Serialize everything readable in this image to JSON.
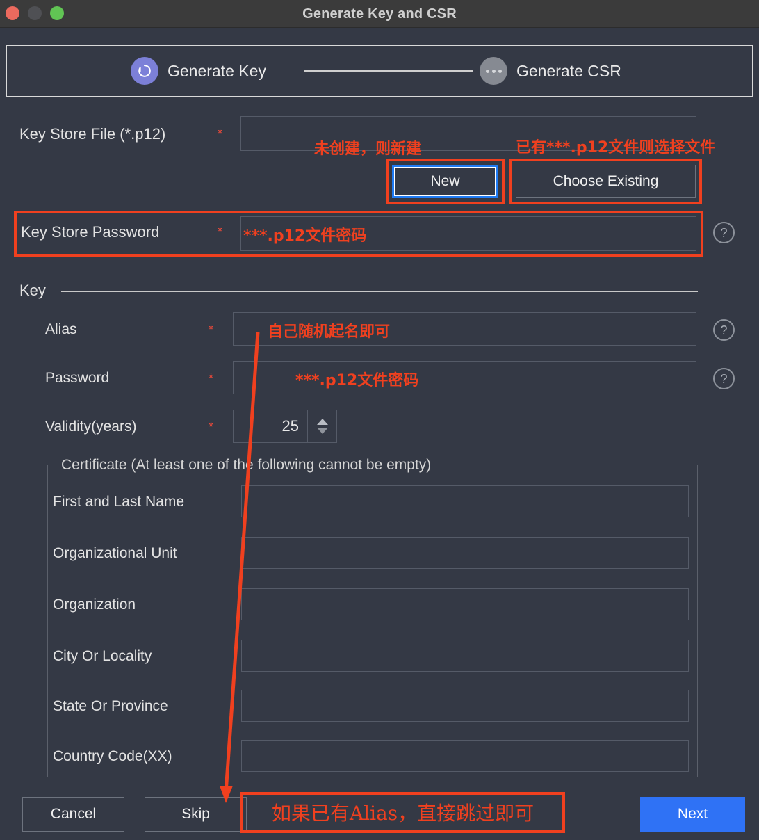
{
  "window": {
    "title": "Generate Key and CSR",
    "traffic_lights": [
      "close-red",
      "minimize-gray",
      "zoom-green"
    ]
  },
  "stepper": {
    "steps": [
      {
        "label": "Generate Key",
        "state": "active",
        "icon": "key-ring-icon"
      },
      {
        "label": "Generate CSR",
        "state": "inactive",
        "icon": "ellipsis-icon"
      }
    ]
  },
  "form": {
    "key_store_file": {
      "label": "Key Store File (*.p12)",
      "required_mark": "*",
      "value": "",
      "buttons": {
        "new": "New",
        "choose_existing": "Choose Existing"
      }
    },
    "key_store_password": {
      "label": "Key Store Password",
      "required_mark": "*",
      "value": "",
      "help": "?"
    },
    "key_section": {
      "title": "Key",
      "alias": {
        "label": "Alias",
        "required_mark": "*",
        "value": "",
        "help": "?"
      },
      "password": {
        "label": "Password",
        "required_mark": "*",
        "value": "",
        "help": "?"
      },
      "validity": {
        "label": "Validity(years)",
        "required_mark": "*",
        "value": "25"
      }
    },
    "certificate": {
      "legend": "Certificate (At least one of the following cannot be empty)",
      "fields": [
        {
          "label": "First and Last Name",
          "value": ""
        },
        {
          "label": "Organizational Unit",
          "value": ""
        },
        {
          "label": "Organization",
          "value": ""
        },
        {
          "label": "City Or Locality",
          "value": ""
        },
        {
          "label": "State Or Province",
          "value": ""
        },
        {
          "label": "Country Code(XX)",
          "value": ""
        }
      ]
    }
  },
  "footer": {
    "cancel": "Cancel",
    "skip": "Skip",
    "next": "Next"
  },
  "annotations": {
    "new_hint": "未创建，则新建",
    "choose_hint": "已有***.p12文件则选择文件",
    "key_store_password_hint": "***.p12文件密码",
    "alias_hint": "自己随机起名即可",
    "key_password_hint": "***.p12文件密码",
    "skip_hint": "如果已有Alias，直接跳过即可"
  },
  "colors": {
    "annotation_red": "#f0401f",
    "focus_blue": "#1f7bf4",
    "primary_button": "#2f72f5",
    "step_active": "#7c80d8",
    "step_inactive": "#868a92",
    "background": "#343945",
    "titlebar": "#3b3b3b"
  }
}
